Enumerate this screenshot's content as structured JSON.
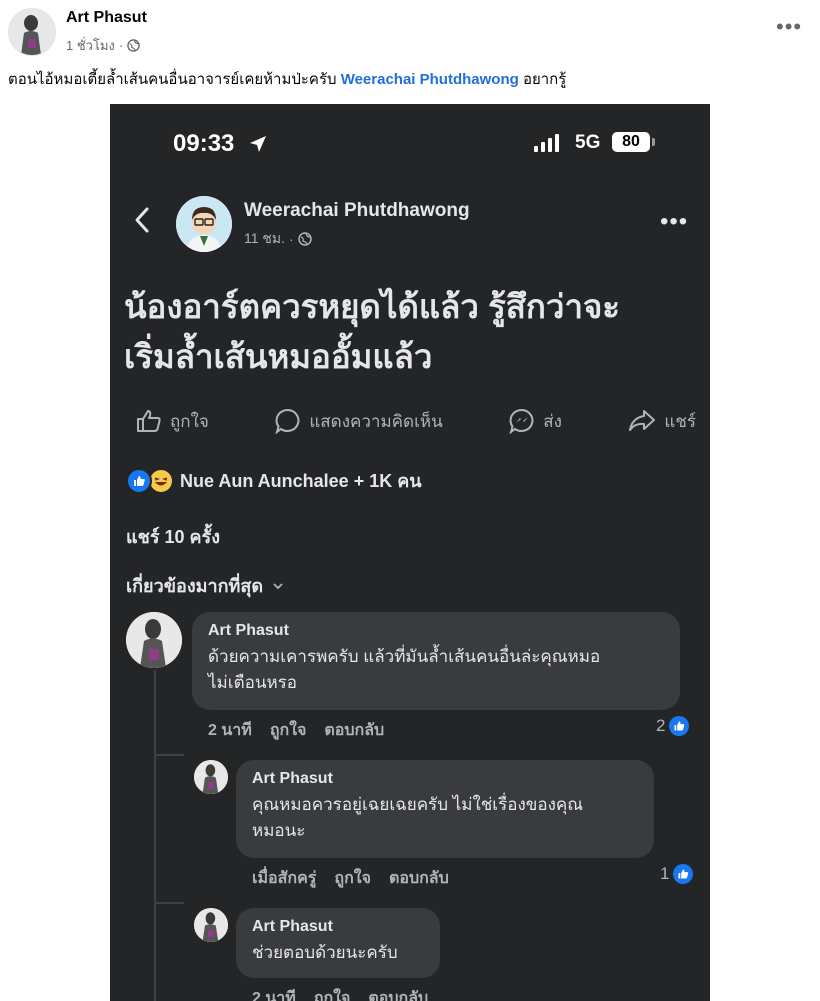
{
  "outer_post": {
    "author": "Art Phasut",
    "time": "1 ชั่วโมง",
    "sep": "·",
    "caption_before": "ตอนไอ้หมอเตี้ยล้ำเส้นคนอื่นอาจารย์เคยห้ามป่ะครับ ",
    "caption_mention": "Weerachai Phutdhawong",
    "caption_after": " อยากรู้"
  },
  "screenshot": {
    "status": {
      "clock": "09:33",
      "network": "5G",
      "battery": "80"
    },
    "page": {
      "name": "Weerachai Phutdhawong",
      "time": "11 ชม.",
      "sep": "·"
    },
    "post_text_line1": "น้องอาร์ตควรหยุดได้แล้ว รู้สึกว่าจะ",
    "post_text_line2": "เริ่มล้ำเส้นหมออั้มแล้ว",
    "actions": {
      "like": "ถูกใจ",
      "comment": "แสดงความคิดเห็น",
      "send": "ส่ง",
      "share": "แชร์"
    },
    "reactions_text": "Nue Aun Aunchalee + 1K คน",
    "shares_text": "แชร์ 10 ครั้ง",
    "sort_label": "เกี่ยวข้องมากที่สุด",
    "comments": [
      {
        "name": "Art Phasut",
        "line1": "ด้วยความเคารพครับ แล้วที่มันล้ำเส้นคนอื่นล่ะคุณหมอ",
        "line2": "ไม่เตือนหรอ",
        "time": "2 นาที",
        "like": "ถูกใจ",
        "reply": "ตอบกลับ",
        "likes": "2"
      },
      {
        "name": "Art Phasut",
        "line1": "คุณหมอควรอยู่เฉยเฉยครับ ไม่ใช่เรื่องของคุณ",
        "line2": "หมอนะ",
        "time": "เมื่อสักครู่",
        "like": "ถูกใจ",
        "reply": "ตอบกลับ",
        "likes": "1"
      },
      {
        "name": "Art Phasut",
        "line1": "ช่วยตอบด้วยนะครับ",
        "time": "2 นาที",
        "like": "ถูกใจ",
        "reply": "ตอบกลับ"
      }
    ]
  },
  "colors": {
    "mention": "#216fdb",
    "dark_bg": "#242526",
    "bubble": "#3a3b3c",
    "like_blue": "#1877f2"
  }
}
